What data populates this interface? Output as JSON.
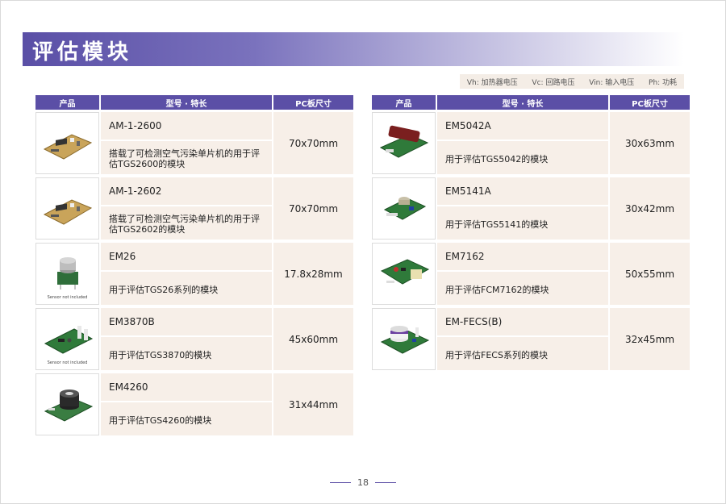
{
  "title": "评估模块",
  "legend": [
    {
      "sym": "Vh:",
      "text": "加热器电压"
    },
    {
      "sym": "Vc:",
      "text": "回路电压"
    },
    {
      "sym": "Vin:",
      "text": "输入电压"
    },
    {
      "sym": "Ph:",
      "text": "功耗"
    }
  ],
  "headers": {
    "product": "产品",
    "model": "型号 · 特长",
    "size": "PC板尺寸"
  },
  "left": [
    {
      "model": "AM-1-2600",
      "feature": "搭载了可检测空气污染单片机的用于评估TGS2600的模块",
      "size": "70x70mm",
      "caption": ""
    },
    {
      "model": "AM-1-2602",
      "feature": "搭载了可检测空气污染单片机的用于评估TGS2602的模块",
      "size": "70x70mm",
      "caption": ""
    },
    {
      "model": "EM26",
      "feature": "用于评估TGS26系列的模块",
      "size": "17.8x28mm",
      "caption": "Sensor not included"
    },
    {
      "model": "EM3870B",
      "feature": "用于评估TGS3870的模块",
      "size": "45x60mm",
      "caption": "Sensor not included"
    },
    {
      "model": "EM4260",
      "feature": "用于评估TGS4260的模块",
      "size": "31x44mm",
      "caption": ""
    }
  ],
  "right": [
    {
      "model": "EM5042A",
      "feature": "用于评估TGS5042的模块",
      "size": "30x63mm"
    },
    {
      "model": "EM5141A",
      "feature": "用于评估TGS5141的模块",
      "size": "30x42mm"
    },
    {
      "model": "EM7162",
      "feature": "用于评估FCM7162的模块",
      "size": "50x55mm"
    },
    {
      "model": "EM-FECS(B)",
      "feature": "用于评估FECS系列的模块",
      "size": "32x45mm"
    }
  ],
  "page_number": "18",
  "colors": {
    "header": "#5b4fa6",
    "cell_bg": "#f7efe8",
    "board_green": "#2f7a3a",
    "board_tan": "#c9a45a"
  }
}
